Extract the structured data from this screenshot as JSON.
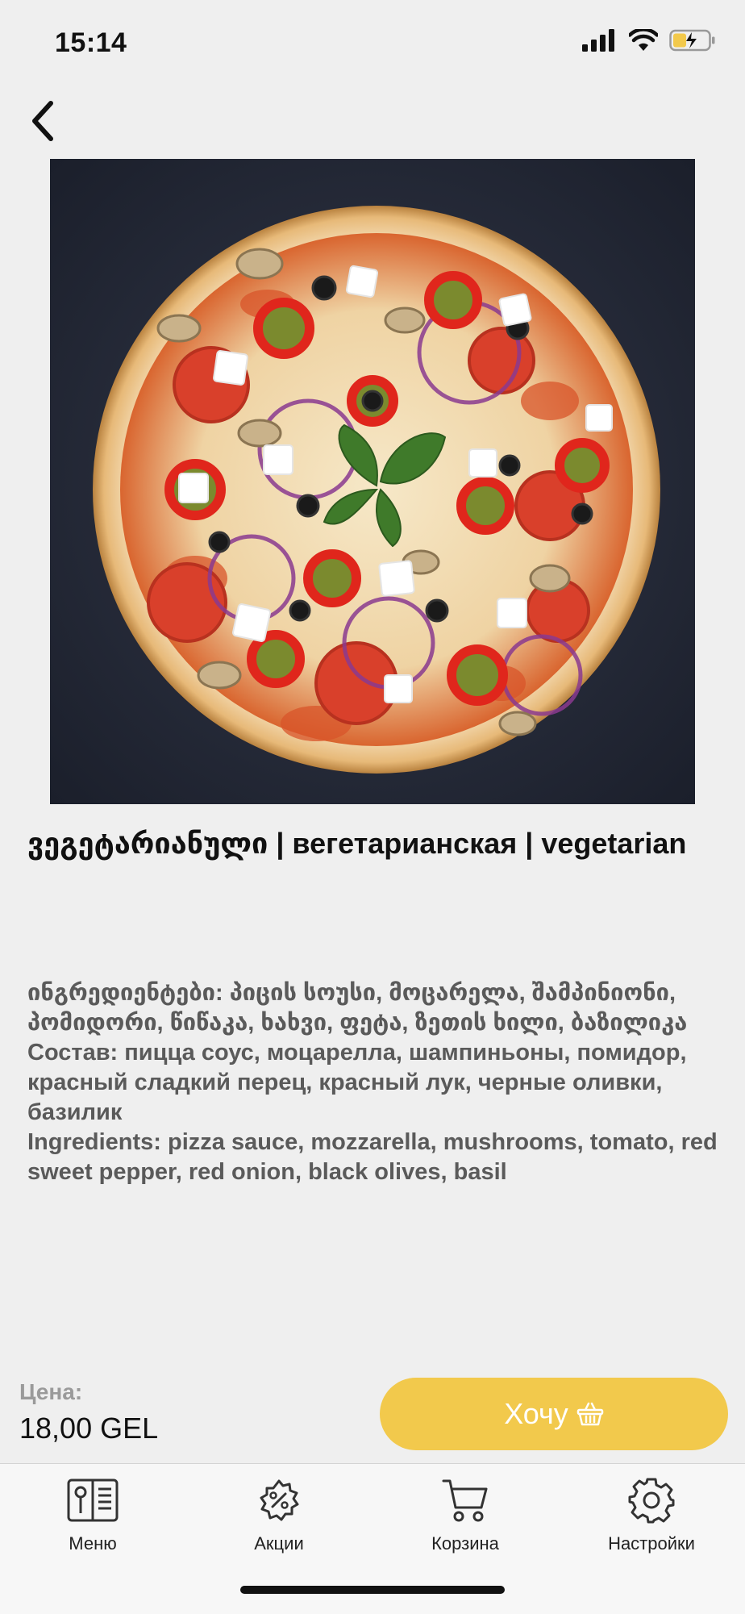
{
  "status": {
    "time": "15:14"
  },
  "product": {
    "title": "ვეგეტარიანული | вегетарианская | vegetarian",
    "image_alt": "pizza",
    "description": [
      "ინგრედიენტები: პიცის სოუსი, მოცარელა, შამპინიონი, პომიდორი, წიწაკა, ხახვი, ფეტა, ზეთის ხილი, ბაზილიკა",
      "Состав: пицца соус, моцарелла, шампиньоны, помидор, красный сладкий перец, красный лук, черные оливки, базилик",
      "Ingredients: pizza sauce, mozzarella, mushrooms, tomato, red sweet pepper, red onion, black olives, basil"
    ]
  },
  "price": {
    "label": "Цена:",
    "value": "18,00 GEL"
  },
  "actions": {
    "want_label": "Хочу",
    "accent_color": "#f2c94c"
  },
  "tabs": [
    {
      "label": "Меню",
      "icon": "menu-book-icon"
    },
    {
      "label": "Акции",
      "icon": "discount-gear-icon"
    },
    {
      "label": "Корзина",
      "icon": "cart-icon"
    },
    {
      "label": "Настройки",
      "icon": "settings-gear-icon"
    }
  ]
}
